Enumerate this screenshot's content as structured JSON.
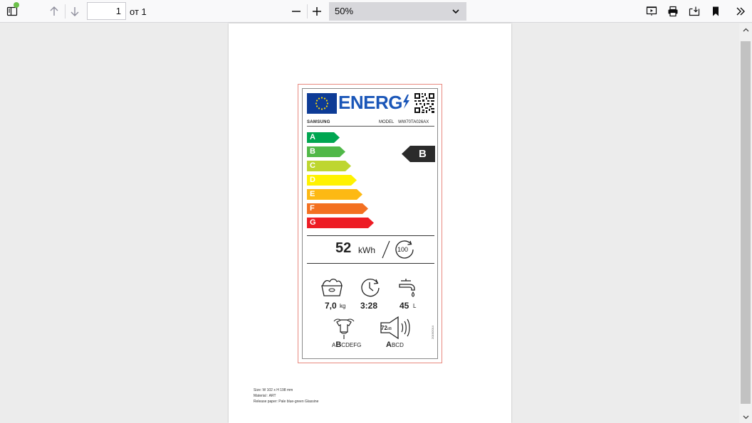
{
  "toolbar": {
    "page_number": "1",
    "page_total": "от 1",
    "zoom": "50%"
  },
  "label": {
    "header_word": "ENERG",
    "brand": "SAMSUNG",
    "model_label": "MODEL",
    "model_value": "WW70TA026AX",
    "scale": [
      "A",
      "B",
      "C",
      "D",
      "E",
      "F",
      "G"
    ],
    "scale_colors": [
      "#00a651",
      "#50b848",
      "#bed630",
      "#fff200",
      "#fdb913",
      "#f37021",
      "#ed1c24"
    ],
    "rating": "B",
    "energy_value": "52",
    "energy_unit": "kWh",
    "cycles": "100",
    "capacity_value": "7,0",
    "capacity_unit": "kg",
    "duration_value": "3:28",
    "water_value": "45",
    "water_unit": "L",
    "spin_class_prefix": "A",
    "spin_class_selected": "B",
    "spin_class_rest": "CDEFG",
    "noise_value": "72",
    "noise_unit": "dB",
    "noise_class_selected": "A",
    "noise_class_rest": "BCD",
    "regulation": "2019/2014"
  },
  "footer": {
    "size": "Size: W 102 x H 198 mm",
    "material": "Material : ART",
    "release": "Release paper: Pale blue-green Glassine"
  },
  "colors": {
    "energy_blue": "#1a56b8",
    "flag_blue": "#0d3b96",
    "badge": "#2b2b2b"
  }
}
